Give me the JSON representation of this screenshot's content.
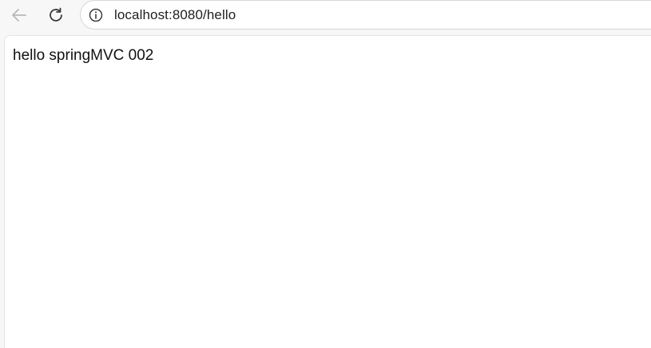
{
  "toolbar": {
    "url": "localhost:8080/hello"
  },
  "page": {
    "body_text": "hello springMVC 002"
  },
  "icons": {
    "back": "back-arrow-icon",
    "reload": "reload-icon",
    "site_info": "info-icon"
  },
  "colors": {
    "chrome_bg": "#f7f7f7",
    "page_bg": "#ffffff",
    "text": "#1f1f1f",
    "disabled_icon": "#b8b8b8"
  }
}
